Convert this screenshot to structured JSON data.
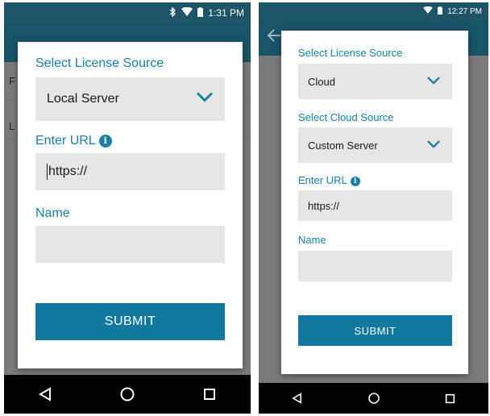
{
  "left": {
    "status_time": "1:31 PM",
    "dialog": {
      "license_label": "Select License Source",
      "license_value": "Local Server",
      "url_label": "Enter URL",
      "url_value": "https://",
      "name_label": "Name",
      "name_value": "",
      "submit_label": "SUBMIT"
    },
    "bg_letters": [
      "F",
      "L"
    ]
  },
  "right": {
    "status_time": "12:27 PM",
    "dialog": {
      "license_label": "Select License Source",
      "license_value": "Cloud",
      "cloud_label": "Select Cloud Source",
      "cloud_value": "Custom Server",
      "url_label": "Enter URL",
      "url_value": "https://",
      "name_label": "Name",
      "name_value": "",
      "submit_label": "SUBMIT"
    }
  },
  "colors": {
    "accent": "#1b7fa2",
    "submit": "#11799d",
    "field_bg": "#e6e6e6",
    "status_bar": "#1d5468"
  },
  "icons": [
    "bluetooth-icon",
    "wifi-icon",
    "battery-icon",
    "info-icon",
    "chevron-down-icon",
    "back-triangle-icon",
    "home-circle-icon",
    "recents-square-icon",
    "back-arrow-icon"
  ]
}
